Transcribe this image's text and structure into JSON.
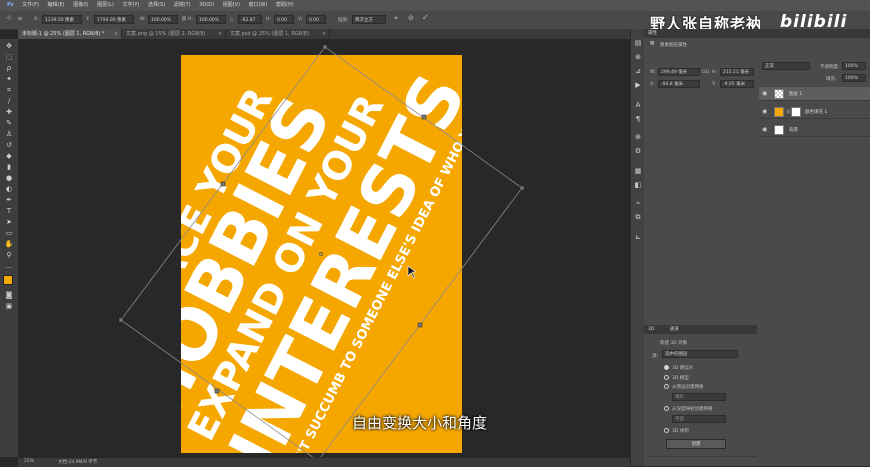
{
  "menu": [
    "文件(F)",
    "编辑(E)",
    "图像(I)",
    "图层(L)",
    "文字(Y)",
    "选择(S)",
    "滤镜(T)",
    "3D(D)",
    "视图(V)",
    "窗口(W)",
    "帮助(H)"
  ],
  "options": {
    "x_label": "X:",
    "x_value": "1239.50 像素",
    "y_label": "Y:",
    "y_value": "1794.00 像素",
    "w_label": "W:",
    "w_value": "100.00%",
    "h_label": "H:",
    "h_value": "100.00%",
    "angle_label": "△",
    "angle_value": "-62.87",
    "hskew_label": "H:",
    "hskew_value": "0.00",
    "vskew_label": "V:",
    "vskew_value": "0.00",
    "interp_label": "插值:",
    "interp_value": "两次立方"
  },
  "watermark": "野人张自称老衲",
  "logo": "bilibili",
  "tabs": [
    {
      "label": "未标题-1 @ 25% (图层 1, RGB/8) *"
    },
    {
      "label": "文案.png @ 25% (图层 2, RGB/8)"
    },
    {
      "label": "文案.psd @ 25% (图层 1, RGB/8)"
    }
  ],
  "poster": {
    "lines": [
      "EMBRACE YOUR",
      "HOBBIES",
      "EXPAND ON YOUR",
      "INTERESTS",
      "DON'T SUCCUMB TO SOMEONE ELSE'S IDEA OF WHO YOU ARE"
    ],
    "bg": "#f5a700"
  },
  "status": {
    "zoom": "25%",
    "doc": "文档:24.9M/0 字节"
  },
  "properties": {
    "header": "属性",
    "subtitle": "像素图层属性",
    "w_label": "W:",
    "w_value": "299.49 毫米",
    "h_label": "H:",
    "h_value": "215.11 毫米",
    "x_label": "X:",
    "x_value": "-94.8 毫米",
    "y_label": "Y:",
    "y_value": "-9.05 毫米",
    "link_label": "GO"
  },
  "layers": {
    "blend_mode": "正常",
    "opacity_label": "不透明度:",
    "opacity_value": "100%",
    "fill_label": "填充:",
    "fill_value": "100%",
    "items": [
      {
        "name": "图层 1"
      },
      {
        "name": "颜色填充 1"
      },
      {
        "name": "背景"
      }
    ]
  },
  "panel3d": {
    "tab": "3D",
    "tab2": "通道",
    "title": "新建 3D 对象",
    "source_label": "源:",
    "source_value": "选中的图层",
    "options": [
      "3D 明信片",
      "3D 模型",
      "从预设创建网格",
      "从深度映射创建网格",
      "3D 体积"
    ],
    "dropdown1": "帽形",
    "dropdown2": "平面",
    "create_button": "创建"
  },
  "subtitle": "自由变换大小和角度"
}
